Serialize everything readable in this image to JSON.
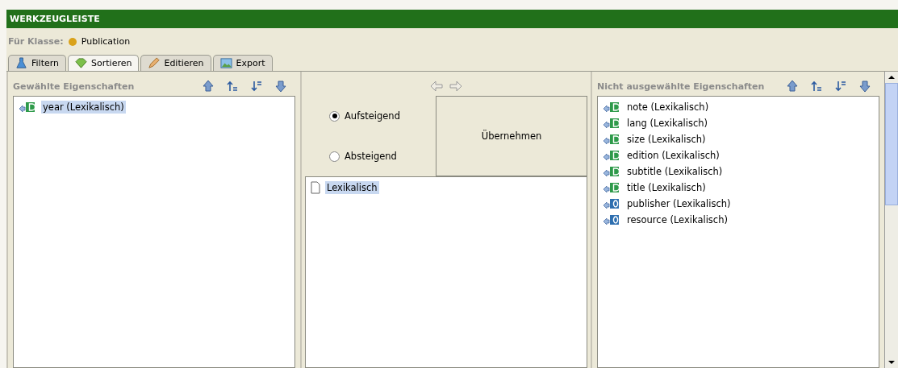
{
  "toolbar": {
    "title": "WERKZEUGLEISTE"
  },
  "class_row": {
    "label": "Für Klasse:",
    "value": "Publication",
    "color": "#d9a21b"
  },
  "tabs": [
    {
      "label": "Filtern",
      "kind": "flask",
      "selected": false
    },
    {
      "label": "Sortieren",
      "kind": "gem",
      "selected": true
    },
    {
      "label": "Editieren",
      "kind": "pencil",
      "selected": false
    },
    {
      "label": "Export",
      "kind": "image",
      "selected": false
    }
  ],
  "selected_panel": {
    "title": "Gewählte Eigenschaften",
    "items": [
      {
        "label": "year (Lexikalisch)",
        "kind": "datatype",
        "selected": true
      }
    ]
  },
  "middle_panel": {
    "radios": [
      {
        "label": "Aufsteigend",
        "selected": true
      },
      {
        "label": "Absteigend",
        "selected": false
      }
    ],
    "apply_button": "Übernehmen",
    "items": [
      {
        "label": "Lexikalisch",
        "selected": true
      }
    ]
  },
  "unselected_panel": {
    "title": "Nicht ausgewählte Eigenschaften",
    "items": [
      {
        "label": "note (Lexikalisch)",
        "kind": "datatype",
        "selected": false
      },
      {
        "label": "lang (Lexikalisch)",
        "kind": "datatype",
        "selected": false
      },
      {
        "label": "size (Lexikalisch)",
        "kind": "datatype",
        "selected": false
      },
      {
        "label": "edition (Lexikalisch)",
        "kind": "datatype",
        "selected": false
      },
      {
        "label": "subtitle (Lexikalisch)",
        "kind": "datatype",
        "selected": false
      },
      {
        "label": "title (Lexikalisch)",
        "kind": "datatype",
        "selected": false
      },
      {
        "label": "publisher (Lexikalisch)",
        "kind": "object",
        "selected": false
      },
      {
        "label": "resource (Lexikalisch)",
        "kind": "object",
        "selected": false
      }
    ]
  }
}
